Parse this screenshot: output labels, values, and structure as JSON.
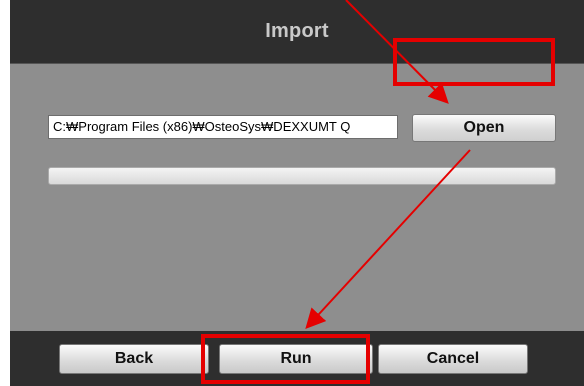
{
  "dialog": {
    "title": "Import"
  },
  "file": {
    "path": "C:\\Program Files (x86)\\OsteoSys\\DEXXUMT Q",
    "path_display": "C:₩Program Files (x86)₩OsteoSys₩DEXXUMT Q",
    "open_label": "Open"
  },
  "progress": {
    "fraction": 0
  },
  "buttons": {
    "back_label": "Back",
    "run_label": "Run",
    "cancel_label": "Cancel"
  },
  "annotation": {
    "highlight_color": "#e50000",
    "arrow_color": "#e50000"
  },
  "icons": {
    "arrow": "red-pointer-arrow"
  }
}
